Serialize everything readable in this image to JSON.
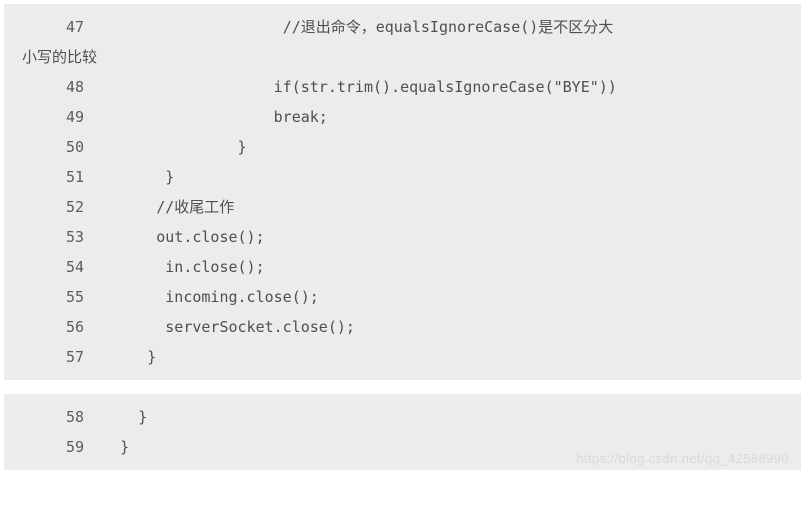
{
  "block1": {
    "lines": [
      {
        "num": "47",
        "text": "                   //退出命令，equalsIgnoreCase()是不区分大"
      },
      {
        "wrap": true,
        "text": "小写的比较"
      },
      {
        "num": "48",
        "text": "                  if(str.trim().equalsIgnoreCase(\"BYE\"))"
      },
      {
        "num": "49",
        "text": "                  break;"
      },
      {
        "num": "50",
        "text": "              }"
      },
      {
        "num": "51",
        "text": "      }"
      },
      {
        "num": "52",
        "text": "     //收尾工作"
      },
      {
        "num": "53",
        "text": "     out.close();"
      },
      {
        "num": "54",
        "text": "      in.close();"
      },
      {
        "num": "55",
        "text": "      incoming.close();"
      },
      {
        "num": "56",
        "text": "      serverSocket.close();"
      },
      {
        "num": "57",
        "text": "    }"
      }
    ]
  },
  "block2": {
    "lines": [
      {
        "num": "58",
        "text": "   }"
      },
      {
        "num": "59",
        "text": " }"
      }
    ],
    "watermark": "https://blog.csdn.net/qq_42588990"
  }
}
